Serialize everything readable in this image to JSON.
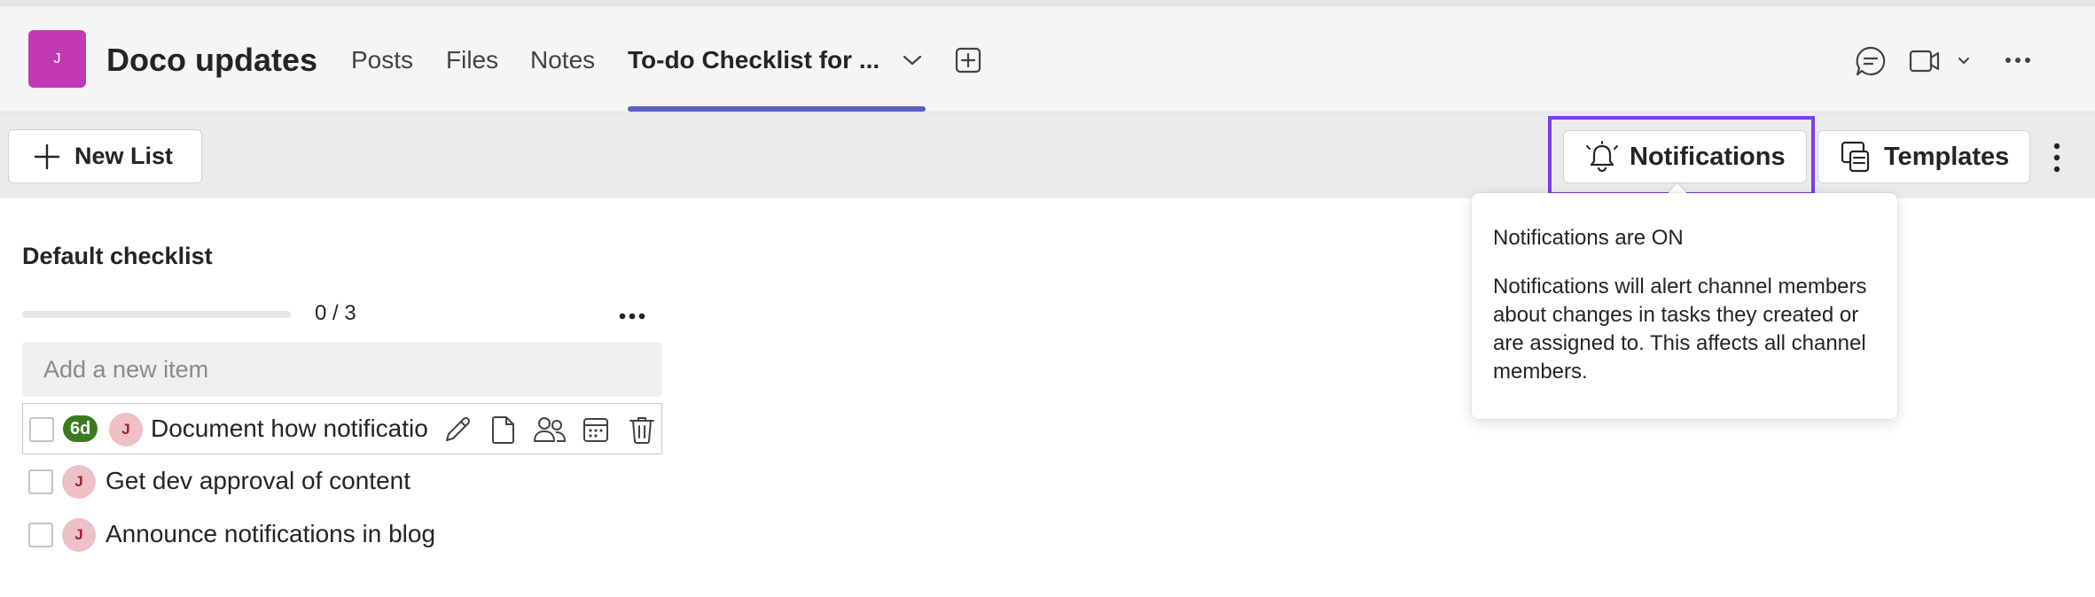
{
  "header": {
    "team_initial": "J",
    "channel_name": "Doco updates",
    "tabs": [
      {
        "label": "Posts"
      },
      {
        "label": "Files"
      },
      {
        "label": "Notes"
      },
      {
        "label": "To-do Checklist for ..."
      }
    ],
    "active_tab": "To-do Checklist for ...",
    "accent_color": "#5b5fc7",
    "avatar_color": "#c239b3",
    "icons": [
      "chevron-down-icon",
      "add-tab-icon",
      "chat-icon",
      "video-icon",
      "more-icon"
    ]
  },
  "toolbar": {
    "new_list_label": "New List",
    "notifications_label": "Notifications",
    "templates_label": "Templates",
    "highlight_color": "#7a3ee8"
  },
  "checklist": {
    "title": "Default checklist",
    "progress_text": "0 / 3",
    "progress_fraction": 0,
    "add_placeholder": "Add a new item",
    "items": [
      {
        "text": "Document how notificatio",
        "avatar": "J",
        "due_badge": "6d",
        "checked": false
      },
      {
        "text": "Get dev approval of content",
        "avatar": "J",
        "checked": false
      },
      {
        "text": "Announce notifications in blog",
        "avatar": "J",
        "checked": false
      }
    ],
    "badge_color": "#3b7a1f"
  },
  "tooltip": {
    "title": "Notifications are ON",
    "body": "Notifications will alert channel members about changes in tasks they created or are assigned to. This affects all channel members."
  }
}
